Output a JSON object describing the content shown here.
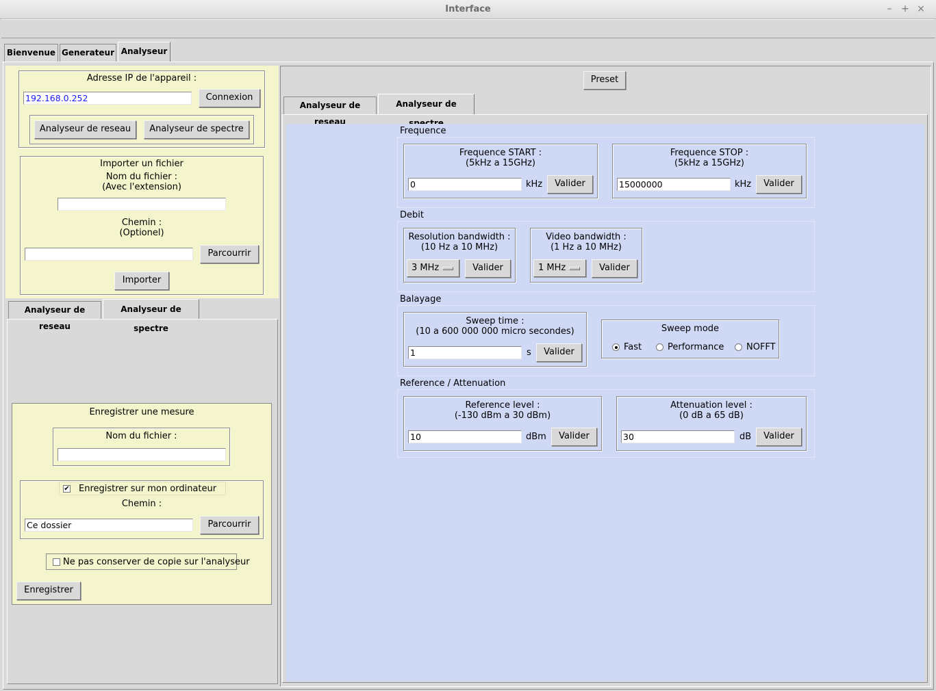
{
  "window": {
    "title": "Interface",
    "controls": [
      "–",
      "+",
      "×"
    ]
  },
  "main_tabs": [
    "Bienvenue",
    "Generateur",
    "Analyseur"
  ],
  "left": {
    "ip_label": "Adresse IP de l'appareil :",
    "ip_value": "192.168.0.252",
    "connect_button": "Connexion",
    "mode_network_button": "Analyseur de reseau",
    "mode_spectrum_button": "Analyseur de spectre",
    "import": {
      "title": "Importer un fichier",
      "filename_label": "Nom du fichier :",
      "filename_hint": "(Avec l'extension)",
      "filename_value": "",
      "path_label": "Chemin :",
      "path_hint": "(Optionel)",
      "path_value": "",
      "browse_button": "Parcourrir",
      "import_button": "Importer"
    },
    "sub_tabs": [
      "Analyseur de reseau",
      "Analyseur de spectre"
    ],
    "save": {
      "title": "Enregistrer une mesure",
      "filename_label": "Nom du fichier :",
      "filename_value": "",
      "save_local_label": "Enregistrer sur mon ordinateur",
      "save_local_checked": true,
      "path_label": "Chemin :",
      "path_value": "Ce dossier",
      "browse_button": "Parcourrir",
      "no_copy_label": "Ne pas conserver de copie sur l'analyseur",
      "no_copy_checked": false,
      "save_button": "Enregistrer"
    }
  },
  "right": {
    "preset_button": "Preset",
    "tabs": [
      "Analyseur de reseau",
      "Analyseur de spectre"
    ],
    "frequence": {
      "section": "Frequence",
      "start_label": "Frequence START :",
      "start_range": "(5kHz a 15GHz)",
      "start_value": "0",
      "start_unit": "kHz",
      "stop_label": "Frequence STOP :",
      "stop_range": "(5kHz a 15GHz)",
      "stop_value": "15000000",
      "stop_unit": "kHz",
      "validate": "Valider"
    },
    "debit": {
      "section": "Debit",
      "rbw_label": "Resolution bandwidth :",
      "rbw_range": "(10 Hz a 10 MHz)",
      "rbw_value": "3 MHz",
      "vbw_label": "Video bandwidth :",
      "vbw_range": "(1 Hz a 10 MHz)",
      "vbw_value": "1 MHz",
      "validate": "Valider"
    },
    "balayage": {
      "section": "Balayage",
      "sweep_time_label": "Sweep time :",
      "sweep_time_range": "(10 a 600 000 000 micro secondes)",
      "sweep_time_value": "1",
      "sweep_time_unit": "s",
      "validate": "Valider",
      "sweep_mode_label": "Sweep mode",
      "modes": [
        "Fast",
        "Performance",
        "NOFFT"
      ],
      "selected_mode": "Fast"
    },
    "reference": {
      "section": "Reference / Attenuation",
      "ref_label": "Reference level :",
      "ref_range": "(-130 dBm a 30 dBm)",
      "ref_value": "10",
      "ref_unit": "dBm",
      "att_label": "Attenuation level :",
      "att_range": "(0 dB a 65 dB)",
      "att_value": "30",
      "att_unit": "dB",
      "validate": "Valider"
    }
  },
  "colors": {
    "yellow_panel": "#f5f5cd",
    "blue_panel": "#cfd8f4",
    "ip_text": "#1a1aff"
  }
}
